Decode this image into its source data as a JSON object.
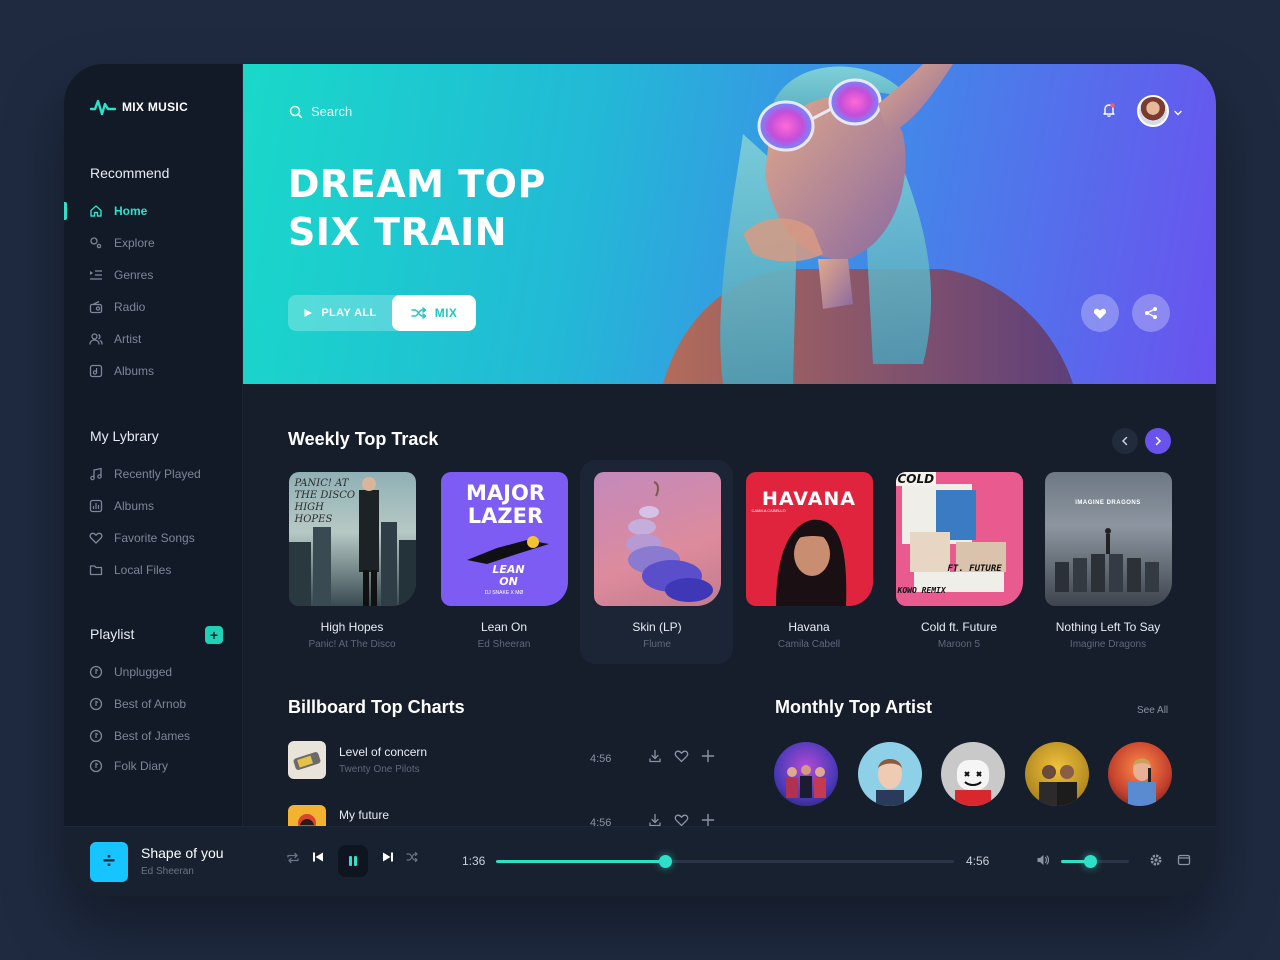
{
  "app": {
    "name": "MIX MUSIC"
  },
  "sidebar": {
    "recommend_heading": "Recommend",
    "recommend_items": [
      {
        "label": "Home",
        "icon": "home-icon",
        "active": true
      },
      {
        "label": "Explore",
        "icon": "explore-icon"
      },
      {
        "label": "Genres",
        "icon": "genres-icon"
      },
      {
        "label": "Radio",
        "icon": "radio-icon"
      },
      {
        "label": "Artist",
        "icon": "artist-icon"
      },
      {
        "label": "Albums",
        "icon": "albums-icon"
      }
    ],
    "library_heading": "My Lybrary",
    "library_items": [
      {
        "label": "Recently Played",
        "icon": "music-note-icon"
      },
      {
        "label": "Albums",
        "icon": "albums-icon"
      },
      {
        "label": "Favorite Songs",
        "icon": "heart-icon"
      },
      {
        "label": "Local Files",
        "icon": "folder-icon"
      }
    ],
    "playlist_heading": "Playlist",
    "playlist_add": "+",
    "playlist_items": [
      {
        "label": "Unplugged"
      },
      {
        "label": "Best of Arnob"
      },
      {
        "label": "Best of James"
      },
      {
        "label": "Folk Diary"
      }
    ]
  },
  "hero": {
    "search_placeholder": "Search",
    "title_line1": "DREAM TOP",
    "title_line2": "SIX TRAIN",
    "play_all_label": "PLAY ALL",
    "mix_label": "MIX"
  },
  "weekly": {
    "title": "Weekly Top Track",
    "tracks": [
      {
        "title": "High Hopes",
        "artist": "Panic! At The Disco"
      },
      {
        "title": "Lean On",
        "artist": "Ed Sheeran"
      },
      {
        "title": "Skin (LP)",
        "artist": "Flume"
      },
      {
        "title": "Havana",
        "artist": "Camila Cabell"
      },
      {
        "title": "Cold ft. Future",
        "artist": "Maroon 5"
      },
      {
        "title": "Nothing Left To Say",
        "artist": "Imagine Dragons"
      }
    ],
    "cover_text": {
      "high_hopes": "PANIC! AT THE DISCO HIGH HOPES",
      "major_lazer": "MAJOR LAZER",
      "lean_on": "LEAN ON",
      "lazer_credit": "DJ SNAKE X MØ",
      "havana": "HAVANA",
      "havana_sub": "CAMILA CABELLO",
      "cold": "COLD",
      "ft_future": "FT. FUTURE",
      "kowo_remix": "KOWO REMIX",
      "imagine_dragons": "IMAGINE DRAGONS"
    }
  },
  "billboard": {
    "title": "Billboard Top Charts",
    "rows": [
      {
        "title": "Level of concern",
        "artist": "Twenty One Pilots",
        "time": "4:56"
      },
      {
        "title": "My future",
        "artist": "",
        "time": "4:56"
      }
    ]
  },
  "monthly": {
    "title": "Monthly Top Artist",
    "see_all": "See All"
  },
  "player": {
    "title": "Shape of you",
    "artist": "Ed Sheeran",
    "cover_label": "÷",
    "current_time": "1:36",
    "total_time": "4:56",
    "progress": 0.37,
    "volume": 0.42
  },
  "colors": {
    "accent": "#2ee0c8",
    "purple": "#6a52ef",
    "background": "#161e2c"
  }
}
